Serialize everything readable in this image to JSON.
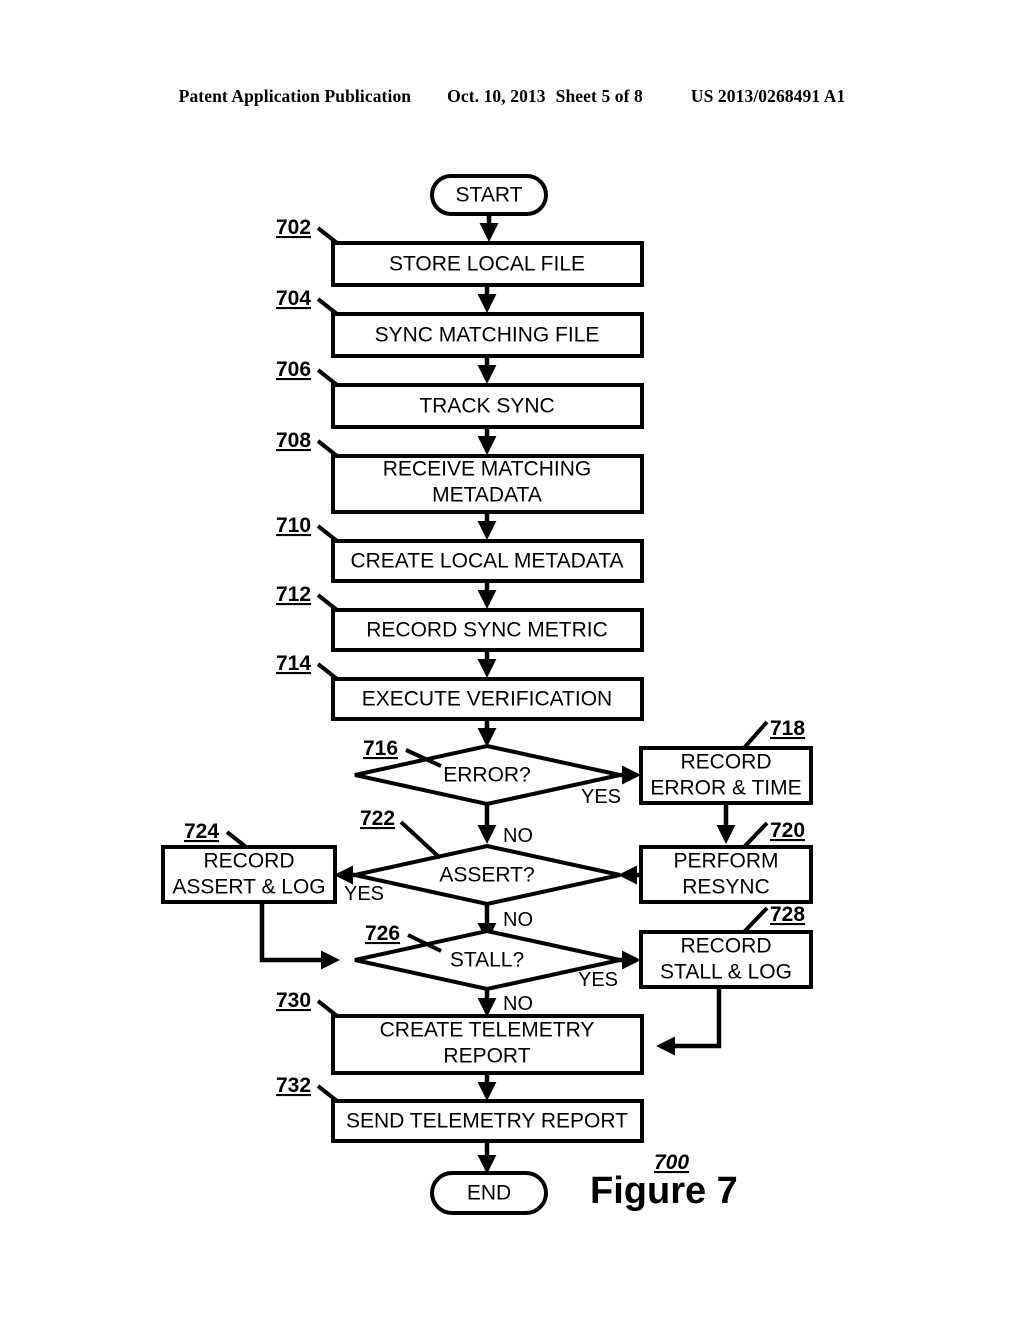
{
  "header": {
    "publication": "Patent Application Publication",
    "date": "Oct. 10, 2013",
    "sheet": "Sheet 5 of 8",
    "patent_number": "US 2013/0268491 A1"
  },
  "figure": {
    "caption": "Figure 7",
    "figure_ref": "700"
  },
  "flowchart": {
    "terminals": [
      {
        "id": "start",
        "label": "START"
      },
      {
        "id": "end",
        "label": "END"
      }
    ],
    "nodes": [
      {
        "ref": "702",
        "label": "STORE LOCAL FILE",
        "type": "process"
      },
      {
        "ref": "704",
        "label": "SYNC MATCHING FILE",
        "type": "process"
      },
      {
        "ref": "706",
        "label": "TRACK SYNC",
        "type": "process"
      },
      {
        "ref": "708",
        "label": "RECEIVE MATCHING METADATA",
        "line1": "RECEIVE MATCHING",
        "line2": "METADATA",
        "type": "process"
      },
      {
        "ref": "710",
        "label": "CREATE LOCAL METADATA",
        "type": "process"
      },
      {
        "ref": "712",
        "label": "RECORD SYNC METRIC",
        "type": "process"
      },
      {
        "ref": "714",
        "label": "EXECUTE VERIFICATION",
        "type": "process"
      },
      {
        "ref": "716",
        "label": "ERROR?",
        "type": "decision"
      },
      {
        "ref": "718",
        "label": "RECORD ERROR & TIME",
        "line1": "RECORD",
        "line2": "ERROR & TIME",
        "type": "process"
      },
      {
        "ref": "720",
        "label": "PERFORM RESYNC",
        "line1": "PERFORM",
        "line2": "RESYNC",
        "type": "process"
      },
      {
        "ref": "722",
        "label": "ASSERT?",
        "type": "decision"
      },
      {
        "ref": "724",
        "label": "RECORD ASSERT & LOG",
        "line1": "RECORD",
        "line2": "ASSERT & LOG",
        "type": "process"
      },
      {
        "ref": "726",
        "label": "STALL?",
        "type": "decision"
      },
      {
        "ref": "728",
        "label": "RECORD STALL & LOG",
        "line1": "RECORD",
        "line2": "STALL & LOG",
        "type": "process"
      },
      {
        "ref": "730",
        "label": "CREATE TELEMETRY REPORT",
        "line1": "CREATE TELEMETRY",
        "line2": "REPORT",
        "type": "process"
      },
      {
        "ref": "732",
        "label": "SEND TELEMETRY REPORT",
        "type": "process"
      }
    ],
    "branch_labels": {
      "error_yes": "YES",
      "error_no": "NO",
      "assert_yes": "YES",
      "assert_no_in": "NO",
      "assert_no_out": "NO",
      "stall_yes": "YES",
      "stall_no_in": "NO",
      "stall_no_out": "NO"
    }
  }
}
